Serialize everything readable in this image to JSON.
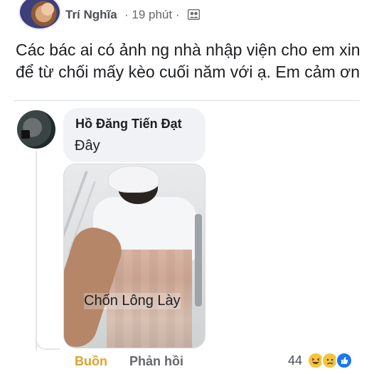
{
  "post": {
    "author": "Trí Nghĩa",
    "meta": "· 19 phút ·",
    "audience_icon": "friends-icon",
    "text": "Các bác ai có ảnh ng nhà nhập viện cho em xin để từ chối mấy kèo cuối năm với ạ. Em cảm ơn"
  },
  "comment": {
    "author": "Hồ Đăng Tiến Đạt",
    "text": "Đây",
    "photo_caption": "Chốn Lông Lày",
    "actions": {
      "react_label": "Buồn",
      "reply_label": "Phản hồi"
    },
    "reaction_count": "44",
    "reaction_icons": [
      "haha-icon",
      "sad-icon",
      "like-icon"
    ],
    "colors": {
      "react_active": "#e0a22b",
      "like_blue": "#1877f2"
    }
  }
}
